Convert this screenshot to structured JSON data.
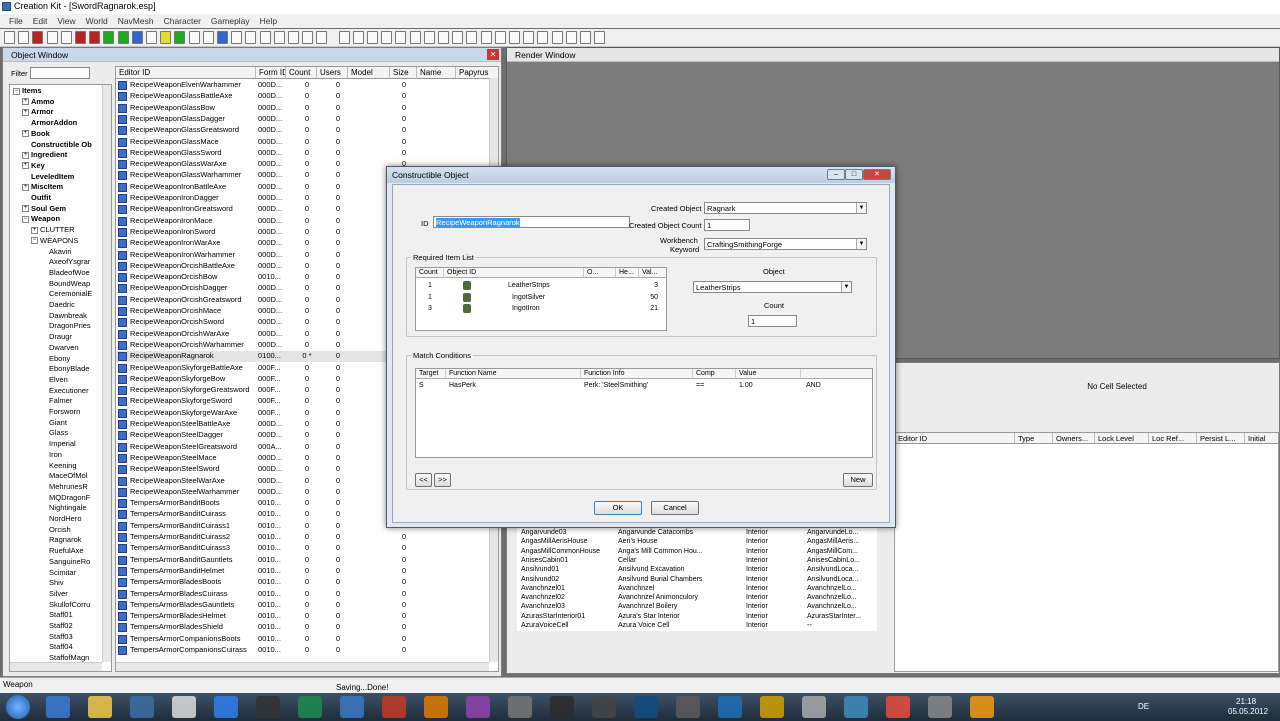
{
  "app": {
    "title": "Creation Kit - [SwordRagnarok.esp]"
  },
  "menu": [
    "File",
    "Edit",
    "View",
    "World",
    "NavMesh",
    "Character",
    "Gameplay",
    "Help"
  ],
  "object_window": {
    "title": "Object Window",
    "filter_label": "Filter",
    "filter_value": "",
    "tree": [
      {
        "label": "Items",
        "bold": true,
        "depth": 0,
        "expander": "-"
      },
      {
        "label": "Ammo",
        "bold": true,
        "depth": 1,
        "expander": "+"
      },
      {
        "label": "Armor",
        "bold": true,
        "depth": 1,
        "expander": "+"
      },
      {
        "label": "ArmorAddon",
        "bold": true,
        "depth": 1,
        "expander": ""
      },
      {
        "label": "Book",
        "bold": true,
        "depth": 1,
        "expander": "+"
      },
      {
        "label": "Constructible Ob",
        "bold": true,
        "depth": 1,
        "expander": ""
      },
      {
        "label": "Ingredient",
        "bold": true,
        "depth": 1,
        "expander": "+"
      },
      {
        "label": "Key",
        "bold": true,
        "depth": 1,
        "expander": "+"
      },
      {
        "label": "LeveledItem",
        "bold": true,
        "depth": 1,
        "expander": ""
      },
      {
        "label": "MiscItem",
        "bold": true,
        "depth": 1,
        "expander": "+"
      },
      {
        "label": "Outfit",
        "bold": true,
        "depth": 1,
        "expander": ""
      },
      {
        "label": "Soul Gem",
        "bold": true,
        "depth": 1,
        "expander": "+"
      },
      {
        "label": "Weapon",
        "bold": true,
        "depth": 1,
        "expander": "-"
      },
      {
        "label": "CLUTTER",
        "bold": false,
        "depth": 2,
        "expander": "+"
      },
      {
        "label": "WEAPONS",
        "bold": false,
        "depth": 2,
        "expander": "-"
      },
      {
        "label": "Akaviri",
        "bold": false,
        "depth": 3,
        "expander": ""
      },
      {
        "label": "AxeofYsgrar",
        "bold": false,
        "depth": 3,
        "expander": ""
      },
      {
        "label": "BladeofWoe",
        "bold": false,
        "depth": 3,
        "expander": ""
      },
      {
        "label": "BoundWeap",
        "bold": false,
        "depth": 3,
        "expander": ""
      },
      {
        "label": "CeremonialE",
        "bold": false,
        "depth": 3,
        "expander": ""
      },
      {
        "label": "Daedric",
        "bold": false,
        "depth": 3,
        "expander": ""
      },
      {
        "label": "Dawnbreak",
        "bold": false,
        "depth": 3,
        "expander": ""
      },
      {
        "label": "DragonPries",
        "bold": false,
        "depth": 3,
        "expander": ""
      },
      {
        "label": "Draugr",
        "bold": false,
        "depth": 3,
        "expander": ""
      },
      {
        "label": "Dwarven",
        "bold": false,
        "depth": 3,
        "expander": ""
      },
      {
        "label": "Ebony",
        "bold": false,
        "depth": 3,
        "expander": ""
      },
      {
        "label": "EbonyBlade",
        "bold": false,
        "depth": 3,
        "expander": ""
      },
      {
        "label": "Elven",
        "bold": false,
        "depth": 3,
        "expander": ""
      },
      {
        "label": "Executioner",
        "bold": false,
        "depth": 3,
        "expander": ""
      },
      {
        "label": "Falmer",
        "bold": false,
        "depth": 3,
        "expander": ""
      },
      {
        "label": "Forsworn",
        "bold": false,
        "depth": 3,
        "expander": ""
      },
      {
        "label": "Giant",
        "bold": false,
        "depth": 3,
        "expander": ""
      },
      {
        "label": "Glass",
        "bold": false,
        "depth": 3,
        "expander": ""
      },
      {
        "label": "Imperial",
        "bold": false,
        "depth": 3,
        "expander": ""
      },
      {
        "label": "Iron",
        "bold": false,
        "depth": 3,
        "expander": ""
      },
      {
        "label": "Keening",
        "bold": false,
        "depth": 3,
        "expander": ""
      },
      {
        "label": "MaceOfMol",
        "bold": false,
        "depth": 3,
        "expander": ""
      },
      {
        "label": "MehrunesR",
        "bold": false,
        "depth": 3,
        "expander": ""
      },
      {
        "label": "MQDragonF",
        "bold": false,
        "depth": 3,
        "expander": ""
      },
      {
        "label": "Nightingale",
        "bold": false,
        "depth": 3,
        "expander": ""
      },
      {
        "label": "NordHero",
        "bold": false,
        "depth": 3,
        "expander": ""
      },
      {
        "label": "Orcish",
        "bold": false,
        "depth": 3,
        "expander": ""
      },
      {
        "label": "Ragnarok",
        "bold": false,
        "depth": 3,
        "expander": ""
      },
      {
        "label": "RuefulAxe",
        "bold": false,
        "depth": 3,
        "expander": ""
      },
      {
        "label": "SanguineRo",
        "bold": false,
        "depth": 3,
        "expander": ""
      },
      {
        "label": "Scimitar",
        "bold": false,
        "depth": 3,
        "expander": ""
      },
      {
        "label": "Shiv",
        "bold": false,
        "depth": 3,
        "expander": ""
      },
      {
        "label": "Silver",
        "bold": false,
        "depth": 3,
        "expander": ""
      },
      {
        "label": "SkullofCorru",
        "bold": false,
        "depth": 3,
        "expander": ""
      },
      {
        "label": "Staff01",
        "bold": false,
        "depth": 3,
        "expander": ""
      },
      {
        "label": "Staff02",
        "bold": false,
        "depth": 3,
        "expander": ""
      },
      {
        "label": "Staff03",
        "bold": false,
        "depth": 3,
        "expander": ""
      },
      {
        "label": "Staff04",
        "bold": false,
        "depth": 3,
        "expander": ""
      },
      {
        "label": "StaffofMagn",
        "bold": false,
        "depth": 3,
        "expander": ""
      }
    ],
    "columns": [
      "Editor ID",
      "Form ID",
      "Count",
      "Users",
      "Model",
      "Size",
      "Name",
      "Papyrus"
    ],
    "rows": [
      [
        "RecipeWeaponElvenWarhammer",
        "000D...",
        "0",
        "0",
        "",
        "0"
      ],
      [
        "RecipeWeaponGlassBattleAxe",
        "000D...",
        "0",
        "0",
        "",
        "0"
      ],
      [
        "RecipeWeaponGlassBow",
        "000D...",
        "0",
        "0",
        "",
        "0"
      ],
      [
        "RecipeWeaponGlassDagger",
        "000D...",
        "0",
        "0",
        "",
        "0"
      ],
      [
        "RecipeWeaponGlassGreatsword",
        "000D...",
        "0",
        "0",
        "",
        "0"
      ],
      [
        "RecipeWeaponGlassMace",
        "000D...",
        "0",
        "0",
        "",
        "0"
      ],
      [
        "RecipeWeaponGlassSword",
        "000D...",
        "0",
        "0",
        "",
        "0"
      ],
      [
        "RecipeWeaponGlassWarAxe",
        "000D...",
        "0",
        "0",
        "",
        "0"
      ],
      [
        "RecipeWeaponGlassWarhammer",
        "000D...",
        "0",
        "0",
        "",
        "0"
      ],
      [
        "RecipeWeaponIronBattleAxe",
        "000D...",
        "0",
        "0",
        "",
        "0"
      ],
      [
        "RecipeWeaponIronDagger",
        "000D...",
        "0",
        "0",
        "",
        "0"
      ],
      [
        "RecipeWeaponIronGreatsword",
        "000D...",
        "0",
        "0",
        "",
        "0"
      ],
      [
        "RecipeWeaponIronMace",
        "000D...",
        "0",
        "0",
        "",
        "0"
      ],
      [
        "RecipeWeaponIronSword",
        "000D...",
        "0",
        "0",
        "",
        "0"
      ],
      [
        "RecipeWeaponIronWarAxe",
        "000D...",
        "0",
        "0",
        "",
        "0"
      ],
      [
        "RecipeWeaponIronWarhammer",
        "000D...",
        "0",
        "0",
        "",
        "0"
      ],
      [
        "RecipeWeaponOrcishBattleAxe",
        "000D...",
        "0",
        "0",
        "",
        "0"
      ],
      [
        "RecipeWeaponOrcishBow",
        "0010...",
        "0",
        "0",
        "",
        "0"
      ],
      [
        "RecipeWeaponOrcishDagger",
        "000D...",
        "0",
        "0",
        "",
        "0"
      ],
      [
        "RecipeWeaponOrcishGreatsword",
        "000D...",
        "0",
        "0",
        "",
        "0"
      ],
      [
        "RecipeWeaponOrcishMace",
        "000D...",
        "0",
        "0",
        "",
        "0"
      ],
      [
        "RecipeWeaponOrcishSword",
        "000D...",
        "0",
        "0",
        "",
        "0"
      ],
      [
        "RecipeWeaponOrcishWarAxe",
        "000D...",
        "0",
        "0",
        "",
        "0"
      ],
      [
        "RecipeWeaponOrcishWarhammer",
        "000D...",
        "0",
        "0",
        "",
        "0"
      ],
      [
        "RecipeWeaponRagnarok",
        "0100...",
        "0 *",
        "0",
        "",
        "0"
      ],
      [
        "RecipeWeaponSkyforgeBattleAxe",
        "000F...",
        "0",
        "0",
        "",
        "0"
      ],
      [
        "RecipeWeaponSkyforgeBow",
        "000F...",
        "0",
        "0",
        "",
        "0"
      ],
      [
        "RecipeWeaponSkyforgeGreatsword",
        "000F...",
        "0",
        "0",
        "",
        "0"
      ],
      [
        "RecipeWeaponSkyforgeSword",
        "000F...",
        "0",
        "0",
        "",
        "0"
      ],
      [
        "RecipeWeaponSkyforgeWarAxe",
        "000F...",
        "0",
        "0",
        "",
        "0"
      ],
      [
        "RecipeWeaponSteelBattleAxe",
        "000D...",
        "0",
        "0",
        "",
        "0"
      ],
      [
        "RecipeWeaponSteelDagger",
        "000D...",
        "0",
        "0",
        "",
        "0"
      ],
      [
        "RecipeWeaponSteelGreatsword",
        "000A...",
        "0",
        "0",
        "",
        "0"
      ],
      [
        "RecipeWeaponSteelMace",
        "000D...",
        "0",
        "0",
        "",
        "0"
      ],
      [
        "RecipeWeaponSteelSword",
        "000D...",
        "0",
        "0",
        "",
        "0"
      ],
      [
        "RecipeWeaponSteelWarAxe",
        "000D...",
        "0",
        "0",
        "",
        "0"
      ],
      [
        "RecipeWeaponSteelWarhammer",
        "000D...",
        "0",
        "0",
        "",
        "0"
      ],
      [
        "TempersArmorBanditBoots",
        "0010...",
        "0",
        "0",
        "",
        "0"
      ],
      [
        "TempersArmorBanditCuirass",
        "0010...",
        "0",
        "0",
        "",
        "0"
      ],
      [
        "TempersArmorBanditCuirass1",
        "0010...",
        "0",
        "0",
        "",
        "0"
      ],
      [
        "TempersArmorBanditCuirass2",
        "0010...",
        "0",
        "0",
        "",
        "0"
      ],
      [
        "TempersArmorBanditCuirass3",
        "0010...",
        "0",
        "0",
        "",
        "0"
      ],
      [
        "TempersArmorBanditGauntlets",
        "0010...",
        "0",
        "0",
        "",
        "0"
      ],
      [
        "TempersArmorBanditHelmet",
        "0010...",
        "0",
        "0",
        "",
        "0"
      ],
      [
        "TempersArmorBladesBoots",
        "0010...",
        "0",
        "0",
        "",
        "0"
      ],
      [
        "TempersArmorBladesCuirass",
        "0010...",
        "0",
        "0",
        "",
        "0"
      ],
      [
        "TempersArmorBladesGauntlets",
        "0010...",
        "0",
        "0",
        "",
        "0"
      ],
      [
        "TempersArmorBladesHelmet",
        "0010...",
        "0",
        "0",
        "",
        "0"
      ],
      [
        "TempersArmorBladesShield",
        "0010...",
        "0",
        "0",
        "",
        "0"
      ],
      [
        "TempersArmorCompanionsBoots",
        "0010...",
        "0",
        "0",
        "",
        "0"
      ],
      [
        "TempersArmorCompanionsCuirass",
        "0010...",
        "0",
        "0",
        "",
        "0"
      ]
    ]
  },
  "render_window": {
    "title": "Render Window"
  },
  "cell_view": {
    "header": "No Cell Selected",
    "columns": [
      "Editor ID",
      "Type",
      "Owners...",
      "Lock Level",
      "Loc Ref...",
      "Persist L...",
      "Initial"
    ],
    "cells": [
      [
        "Angarvunde03",
        "Angarvunde Catacombs",
        "Interior",
        "AngarvundeLo..."
      ],
      [
        "AngasMillAerisHouse",
        "Aeri's House",
        "Interior",
        "AngasMillAeris..."
      ],
      [
        "AngasMillCommonHouse",
        "Anga's Mill Common Hou...",
        "Interior",
        "AngasMillCom..."
      ],
      [
        "AnisesCabin01",
        "Cellar",
        "Interior",
        "AnisesCabinLo..."
      ],
      [
        "Ansilvund01",
        "Ansilvund Excavation",
        "Interior",
        "AnsilvundLoca..."
      ],
      [
        "Ansilvund02",
        "Ansilvund Burial Chambers",
        "Interior",
        "AnsilvundLoca..."
      ],
      [
        "Avanchnzel01",
        "Avanchnzel",
        "Interior",
        "AvanchnzelLo..."
      ],
      [
        "Avanchnzel02",
        "Avanchnzel Animonculory",
        "Interior",
        "AvanchnzelLo..."
      ],
      [
        "Avanchnzel03",
        "Avanchnzel Boilery",
        "Interior",
        "AvanchnzelLo..."
      ],
      [
        "AzurasStarInterior01",
        "Azura's Star Interior",
        "Interior",
        "AzurasStarInter..."
      ],
      [
        "AzuraVoiceCell",
        "Azura Voice Cell",
        "Interior",
        "--"
      ]
    ]
  },
  "dialog": {
    "title": "Constructible Object",
    "id_label": "ID",
    "id_value": "RecipeWeaponRagnarok",
    "created_object_label": "Created Object",
    "created_object_value": "Ragnark",
    "created_count_label": "Created Object Count",
    "created_count_value": "1",
    "workbench_label_1": "Workbench",
    "workbench_label_2": "Keyword",
    "workbench_value": "CraftingSmithingForge",
    "required_label": "Required Item List",
    "req_columns": [
      "Count",
      "Object ID",
      "O...",
      "He...",
      "Val..."
    ],
    "req_rows": [
      [
        "1",
        "LeatherStrips",
        "",
        "",
        "3"
      ],
      [
        "1",
        "IngotSilver",
        "",
        "",
        "50"
      ],
      [
        "3",
        "IngotIron",
        "",
        "",
        "21"
      ]
    ],
    "object_label": "Object",
    "object_value": "LeatherStrips",
    "count_label": "Count",
    "count_value": "1",
    "match_label": "Match Conditions",
    "cond_columns": [
      "Target",
      "Function Name",
      "Function Info",
      "Comp",
      "Value",
      ""
    ],
    "cond_rows": [
      [
        "S",
        "HasPerk",
        "Perk: 'SteelSmithing'",
        "==",
        "1.00",
        "AND"
      ]
    ],
    "prev_label": "<<",
    "next_label": ">>",
    "new_label": "New",
    "ok_label": "OK",
    "cancel_label": "Cancel"
  },
  "status": {
    "left": "Weapon",
    "message": "Saving...Done!"
  },
  "taskbar": {
    "lang": "DE",
    "time": "21:18",
    "date": "05.05.2012"
  }
}
